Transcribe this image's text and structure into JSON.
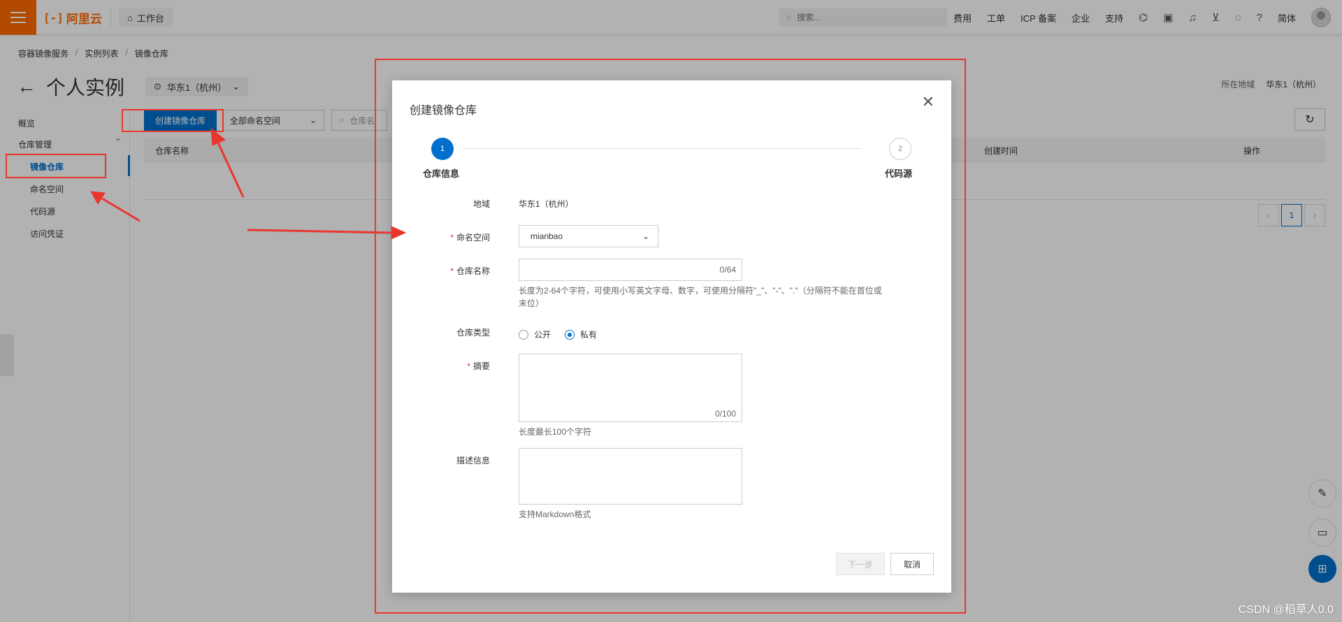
{
  "topbar": {
    "logo_text": "阿里云",
    "logo_mark": "[-]",
    "workbench": "工作台",
    "search_placeholder": "搜索...",
    "links": [
      "费用",
      "工单",
      "ICP 备案",
      "企业",
      "支持"
    ],
    "lang": "简体"
  },
  "breadcrumb": [
    "容器镜像服务",
    "实例列表",
    "镜像仓库"
  ],
  "page": {
    "title": "个人实例",
    "region": "华东1（杭州）",
    "region_label": "所在地域",
    "region_value": "华东1（杭州）"
  },
  "sidebar": {
    "items": [
      "概览",
      "仓库管理",
      "镜像仓库",
      "命名空间",
      "代码源",
      "访问凭证"
    ]
  },
  "toolbar": {
    "create_button": "创建镜像仓库",
    "namespace_filter": "全部命名空间",
    "search_placeholder": "仓库名"
  },
  "table": {
    "columns": [
      "仓库名称",
      "创建时间",
      "操作"
    ]
  },
  "pager": {
    "current": "1"
  },
  "dialog": {
    "title": "创建镜像仓库",
    "steps": [
      {
        "num": "1",
        "label": "仓库信息"
      },
      {
        "num": "2",
        "label": "代码源"
      }
    ],
    "fields": {
      "region_label": "地域",
      "region_value": "华东1（杭州）",
      "namespace_label": "命名空间",
      "namespace_value": "mianbao",
      "repo_name_label": "仓库名称",
      "repo_name_count": "0/64",
      "repo_name_help_1": "长度为2-64个字符，可使用小写英文字母、数字，可使用分隔符\"_\"、\"-\"、\".\"（分隔符不能在首位或",
      "repo_name_help_2": "末位）",
      "repo_type_label": "仓库类型",
      "repo_type_public": "公开",
      "repo_type_private": "私有",
      "summary_label": "摘要",
      "summary_count": "0/100",
      "summary_help": "长度最长100个字符",
      "desc_label": "描述信息",
      "desc_help": "支持Markdown格式"
    },
    "buttons": {
      "next": "下一步",
      "cancel": "取消"
    }
  },
  "watermark": "CSDN @稻草人0.0",
  "colors": {
    "brand_orange": "#ff6a00",
    "primary_blue": "#0070cc",
    "annotation_red": "#e8372f"
  }
}
